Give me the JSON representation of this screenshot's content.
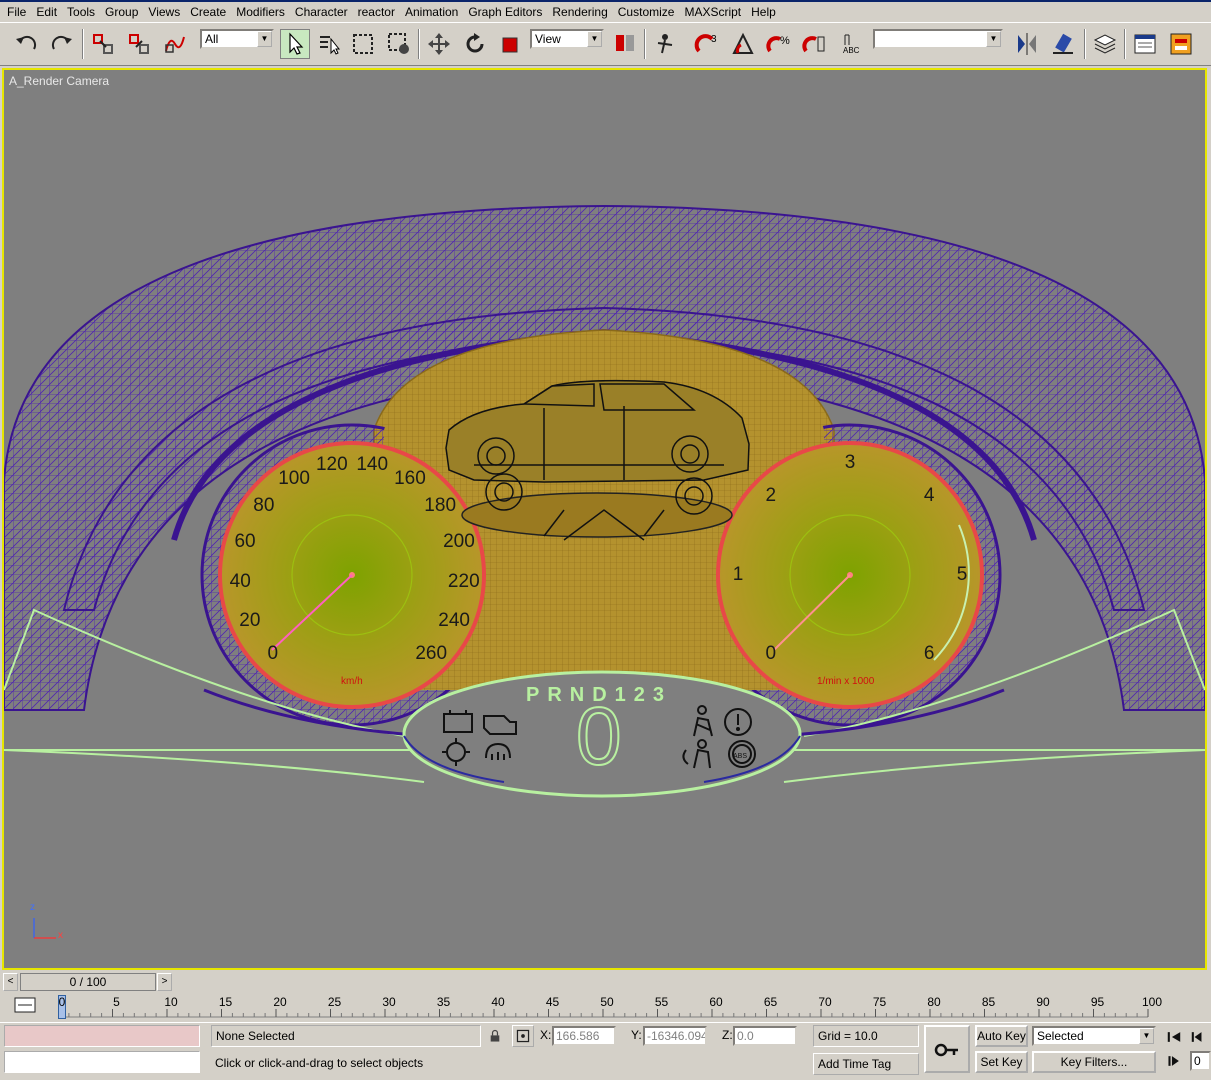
{
  "menu": [
    "File",
    "Edit",
    "Tools",
    "Group",
    "Views",
    "Create",
    "Modifiers",
    "Character",
    "reactor",
    "Animation",
    "Graph Editors",
    "Rendering",
    "Customize",
    "MAXScript",
    "Help"
  ],
  "toolbar": {
    "selection_filter": "All",
    "reference_coord": "View",
    "named_selection": ""
  },
  "viewport": {
    "label": "A_Render Camera",
    "speedo_labels": [
      "0",
      "20",
      "40",
      "60",
      "80",
      "100",
      "120",
      "140",
      "160",
      "180",
      "200",
      "220",
      "240",
      "260"
    ],
    "speedo_unit": "km/h",
    "tacho_labels": [
      "0",
      "1",
      "2",
      "3",
      "4",
      "5",
      "6"
    ],
    "tacho_unit": "1/min x 1000",
    "gear_indicator": "PRND123",
    "gear_value": "0",
    "axis_z": "z",
    "axis_x": "x"
  },
  "timeline": {
    "frame_display": "0 / 100",
    "ticks": [
      "0",
      "5",
      "10",
      "15",
      "20",
      "25",
      "30",
      "35",
      "40",
      "45",
      "50",
      "55",
      "60",
      "65",
      "70",
      "75",
      "80",
      "85",
      "90",
      "95",
      "100"
    ],
    "current_frame": 0
  },
  "status": {
    "selection": "None Selected",
    "prompt": "Click or click-and-drag to select objects",
    "x_label": "X:",
    "x_value": "166.586",
    "y_label": "Y:",
    "y_value": "-16346.094",
    "z_label": "Z:",
    "z_value": "0.0",
    "grid": "Grid = 10.0",
    "add_time_tag": "Add Time Tag",
    "auto_key": "Auto Key",
    "set_key": "Set Key",
    "key_mode": "Selected",
    "key_filters": "Key Filters...",
    "frame_field": "0"
  },
  "colors": {
    "viewport_bg": "#7f7f7f",
    "active_border": "#e6e600",
    "wire_purple": "#4b1fa8",
    "wire_gold": "#b8962a",
    "gauge_red": "#e84848",
    "outline_green": "#b8f0a0"
  }
}
